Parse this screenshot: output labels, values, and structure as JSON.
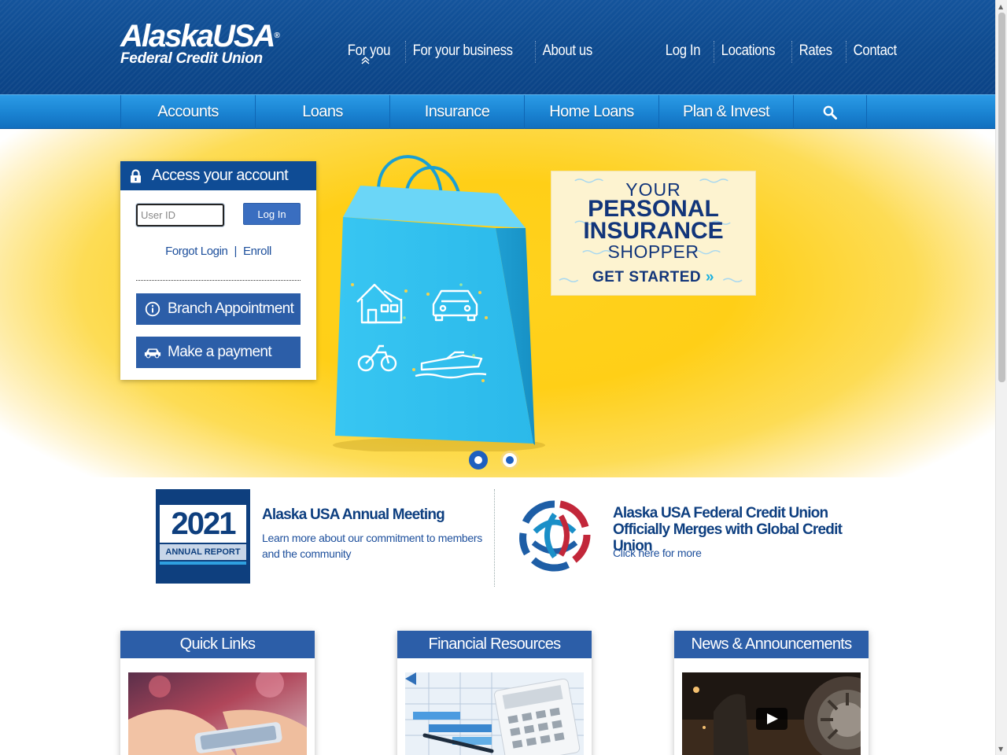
{
  "header": {
    "logo_main": "AlaskaUSA",
    "logo_reg": "®",
    "logo_sub": "Federal Credit Union",
    "segments": [
      "For you",
      "For your business",
      "About us"
    ],
    "utility": [
      "Log In",
      "Locations",
      "Rates",
      "Contact"
    ],
    "active_caret": "»"
  },
  "mainnav": {
    "items": [
      "Accounts",
      "Loans",
      "Insurance",
      "Home Loans",
      "Plan & Invest"
    ],
    "search_icon": "search-icon"
  },
  "access": {
    "title": "Access your account",
    "userid_placeholder": "User ID",
    "login_label": "Log In",
    "forgot": "Forgot Login",
    "sep": "|",
    "enroll": "Enroll",
    "branch_label": "Branch Appointment",
    "payment_label": "Make a payment"
  },
  "promo": {
    "line1": "YOUR",
    "line2": "PERSONAL",
    "line3": "INSURANCE",
    "line4": "SHOPPER",
    "cta": "GET STARTED",
    "cta_chevron": "»"
  },
  "news": [
    {
      "image_year": "2021",
      "image_caption": "ANNUAL REPORT",
      "title": "Alaska USA Annual Meeting",
      "body": "Learn more about our commitment to members and the community"
    },
    {
      "title": "Alaska USA Federal Credit Union Officially Merges with Global Credit Union",
      "body": "Click here for more"
    }
  ],
  "cards": [
    "Quick Links",
    "Financial Resources",
    "News & Announcements"
  ],
  "colors": {
    "header_blue": "#0e4a8e",
    "nav_blue": "#1a83d2",
    "panel_blue": "#2c5ea8",
    "hero_yellow": "#ffd21e"
  }
}
